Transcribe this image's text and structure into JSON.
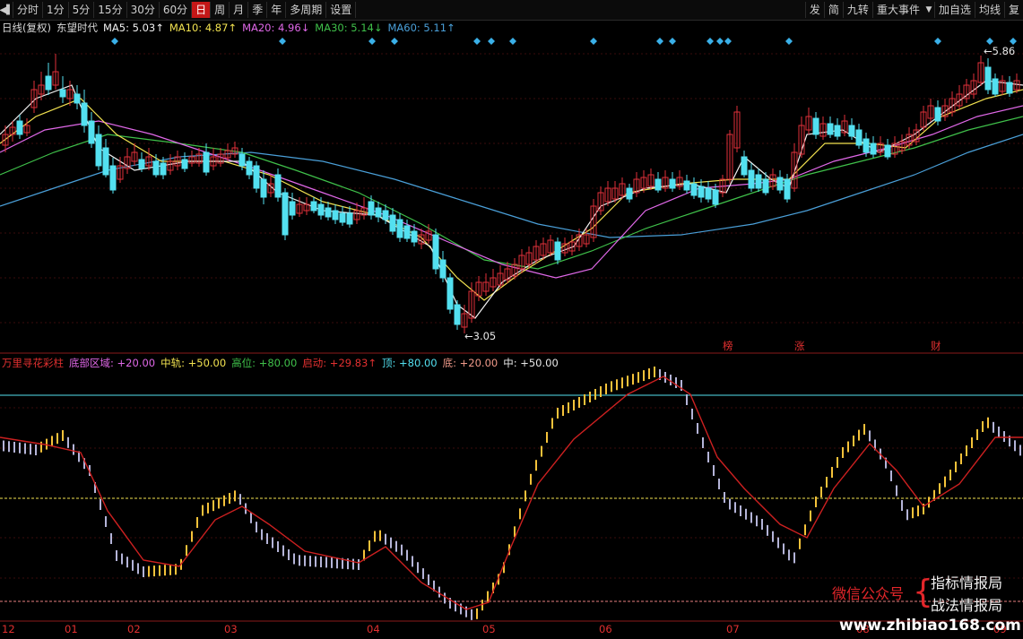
{
  "toolbar": {
    "buttons": [
      "分时",
      "1分",
      "5分",
      "15分",
      "30分",
      "60分",
      "日",
      "周",
      "月",
      "季",
      "年",
      "多周期",
      "设置"
    ],
    "active": "日",
    "right_buttons": [
      "发",
      "简",
      "九转",
      "重大事件",
      "加自选",
      "均线",
      "复"
    ]
  },
  "top_legend": {
    "period": "日线(复权)",
    "stock_name": "东望时代",
    "ma5": "MA5: 5.03↑",
    "ma10": "MA10: 4.87↑",
    "ma20": "MA20: 4.96↓",
    "ma30": "MA30: 5.14↓",
    "ma60": "MA60: 5.11↑"
  },
  "price_labels": {
    "high": "5.86",
    "low": "3.05"
  },
  "event_markers": [
    "榜",
    "涨",
    "财"
  ],
  "indicator_legend": {
    "name": "万里寻花彩柱",
    "bottom_zone": "底部区域: +20.00",
    "mid_rail": "中轨: +50.00",
    "high_pos": "高位: +80.00",
    "start": "启动: +29.83↑",
    "top": "顶: +80.00",
    "bottom": "底: +20.00",
    "mid": "中: +50.00"
  },
  "x_axis": [
    "12",
    "01",
    "02",
    "03",
    "04",
    "05",
    "06",
    "07",
    "08",
    "09"
  ],
  "watermark": {
    "wechat": "微信公众号",
    "line1": "指标情报局",
    "line2": "战法情报局",
    "url": "www.zhibiao168.com"
  },
  "colors": {
    "up": "#e0313a",
    "down": "#53e0f0",
    "ma5": "#f0f0f0",
    "ma10": "#f2e250",
    "ma20": "#e068e8",
    "ma30": "#3fc04a",
    "ma60": "#4a9fd8",
    "bar_up": "#f5c23a",
    "bar_down": "#b4b4d8",
    "signal": "#cc2020"
  }
}
